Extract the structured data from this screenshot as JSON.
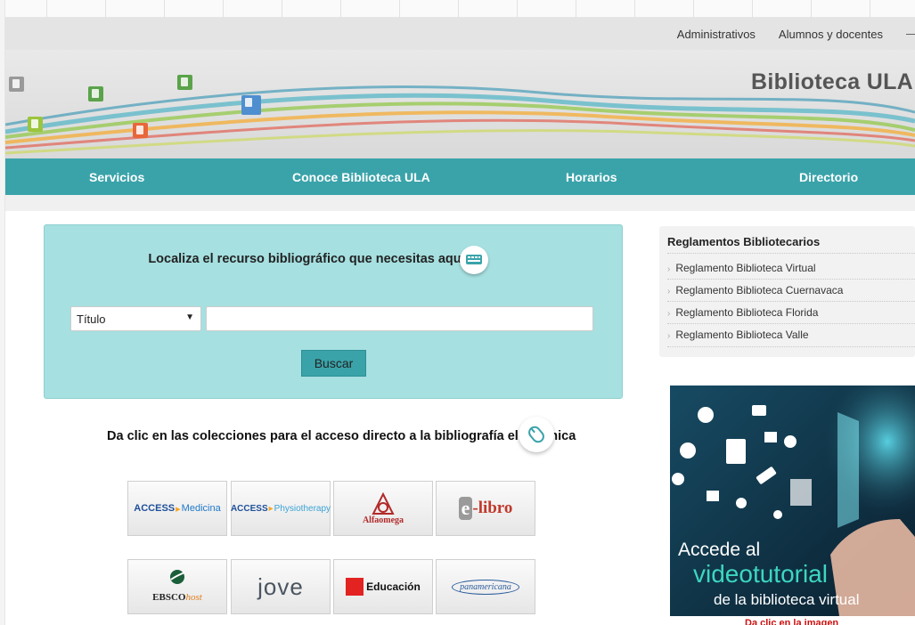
{
  "topbar": {
    "links": [
      "Administrativos",
      "Alumnos y docentes"
    ]
  },
  "banner": {
    "title": "Biblioteca ULA"
  },
  "nav": {
    "items": [
      "Servicios",
      "Conoce Biblioteca ULA",
      "Horarios",
      "Directorio"
    ]
  },
  "search": {
    "title": "Localiza el recurso bibliográfico que necesitas aquí",
    "select_value": "Título",
    "input_value": "",
    "button_label": "Buscar"
  },
  "collections": {
    "title": "Da clic en las colecciones para el acceso directo a la bibliografía electrónica",
    "logos": [
      {
        "a": "ACCESS",
        "b": "Medicina"
      },
      {
        "a": "ACCESS",
        "b": "Physiotherapy"
      },
      {
        "a": "",
        "b": "Alfaomega"
      },
      {
        "a": "e",
        "b": "libro"
      },
      {
        "a": "EBSCO",
        "b": "host"
      },
      {
        "a": "",
        "b": "jove"
      },
      {
        "a": "",
        "b": "Educación"
      },
      {
        "a": "",
        "b": "panamericana"
      }
    ]
  },
  "sidebar": {
    "title": "Reglamentos Bibliotecarios",
    "items": [
      "Reglamento Biblioteca Virtual",
      "Reglamento Biblioteca Cuernavaca",
      "Reglamento Biblioteca Florida",
      "Reglamento Biblioteca Valle"
    ]
  },
  "promo": {
    "line1": "Accede al",
    "line2": "videotutorial",
    "line3": "de la biblioteca virtual",
    "caption": "Da clic en la imagen"
  },
  "colors": {
    "teal": "#3aa3aa",
    "light_teal": "#a6e0e1",
    "red": "#cc1111"
  }
}
